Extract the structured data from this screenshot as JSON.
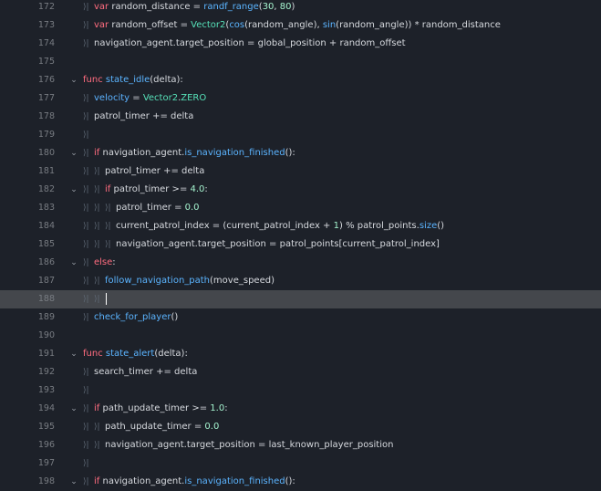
{
  "editor": {
    "current_line": "188",
    "lines": [
      {
        "num": "172",
        "fold": false,
        "tokens": [
          {
            "tab": 1
          },
          {
            "t": "var",
            "c": "kw-red"
          },
          {
            "t": " random_distance = "
          },
          {
            "t": "randf_range",
            "c": "fn"
          },
          {
            "t": "("
          },
          {
            "t": "30",
            "c": "num"
          },
          {
            "t": ", "
          },
          {
            "t": "80",
            "c": "num"
          },
          {
            "t": ")"
          }
        ]
      },
      {
        "num": "173",
        "fold": false,
        "tokens": [
          {
            "tab": 1
          },
          {
            "t": "var",
            "c": "kw-red"
          },
          {
            "t": " random_offset = "
          },
          {
            "t": "Vector2",
            "c": "type-green"
          },
          {
            "t": "("
          },
          {
            "t": "cos",
            "c": "fn"
          },
          {
            "t": "(random_angle), "
          },
          {
            "t": "sin",
            "c": "fn"
          },
          {
            "t": "(random_angle)) * random_distance"
          }
        ]
      },
      {
        "num": "174",
        "fold": false,
        "tokens": [
          {
            "tab": 1
          },
          {
            "t": "navigation_agent."
          },
          {
            "t": "target_position",
            "c": ""
          },
          {
            "t": " = "
          },
          {
            "t": "global_position",
            "c": ""
          },
          {
            "t": " + random_offset"
          }
        ]
      },
      {
        "num": "175",
        "fold": false,
        "tokens": []
      },
      {
        "num": "176",
        "fold": true,
        "tokens": [
          {
            "t": "func",
            "c": "kw-red"
          },
          {
            "t": " "
          },
          {
            "t": "state_idle",
            "c": "fn"
          },
          {
            "t": "(delta):"
          }
        ]
      },
      {
        "num": "177",
        "fold": false,
        "tokens": [
          {
            "tab": 1
          },
          {
            "t": "velocity",
            "c": "builtin"
          },
          {
            "t": " = "
          },
          {
            "t": "Vector2",
            "c": "type-green"
          },
          {
            "t": "."
          },
          {
            "t": "ZERO",
            "c": "type-green"
          }
        ]
      },
      {
        "num": "178",
        "fold": false,
        "tokens": [
          {
            "tab": 1
          },
          {
            "t": "patrol_timer += delta"
          }
        ]
      },
      {
        "num": "179",
        "fold": false,
        "tokens": [
          {
            "tab": 1
          }
        ]
      },
      {
        "num": "180",
        "fold": true,
        "tokens": [
          {
            "tab": 1
          },
          {
            "t": "if",
            "c": "kw-red"
          },
          {
            "t": " navigation_agent."
          },
          {
            "t": "is_navigation_finished",
            "c": "fn"
          },
          {
            "t": "():"
          }
        ]
      },
      {
        "num": "181",
        "fold": false,
        "tokens": [
          {
            "tab": 1
          },
          {
            "tab": 1
          },
          {
            "t": "patrol_timer += delta"
          }
        ]
      },
      {
        "num": "182",
        "fold": true,
        "tokens": [
          {
            "tab": 1
          },
          {
            "tab": 1
          },
          {
            "t": "if",
            "c": "kw-red"
          },
          {
            "t": " patrol_timer >= "
          },
          {
            "t": "4.0",
            "c": "num"
          },
          {
            "t": ":"
          }
        ]
      },
      {
        "num": "183",
        "fold": false,
        "tokens": [
          {
            "tab": 1
          },
          {
            "tab": 1
          },
          {
            "tab": 1
          },
          {
            "t": "patrol_timer = "
          },
          {
            "t": "0.0",
            "c": "num"
          }
        ]
      },
      {
        "num": "184",
        "fold": false,
        "tokens": [
          {
            "tab": 1
          },
          {
            "tab": 1
          },
          {
            "tab": 1
          },
          {
            "t": "current_patrol_index = (current_patrol_index + "
          },
          {
            "t": "1",
            "c": "num"
          },
          {
            "t": ") % patrol_points."
          },
          {
            "t": "size",
            "c": "fn"
          },
          {
            "t": "()"
          }
        ]
      },
      {
        "num": "185",
        "fold": false,
        "tokens": [
          {
            "tab": 1
          },
          {
            "tab": 1
          },
          {
            "tab": 1
          },
          {
            "t": "navigation_agent."
          },
          {
            "t": "target_position",
            "c": ""
          },
          {
            "t": " = patrol_points[current_patrol_index]"
          }
        ]
      },
      {
        "num": "186",
        "fold": true,
        "tokens": [
          {
            "tab": 1
          },
          {
            "t": "else",
            "c": "kw-red"
          },
          {
            "t": ":"
          }
        ]
      },
      {
        "num": "187",
        "fold": false,
        "tokens": [
          {
            "tab": 1
          },
          {
            "tab": 1
          },
          {
            "t": "follow_navigation_path",
            "c": "fn"
          },
          {
            "t": "(move_speed)"
          }
        ]
      },
      {
        "num": "188",
        "fold": false,
        "current": true,
        "tokens": [
          {
            "tab": 1
          },
          {
            "tab": 1
          },
          {
            "caret": true
          }
        ]
      },
      {
        "num": "189",
        "fold": false,
        "tokens": [
          {
            "tab": 1
          },
          {
            "t": "check_for_player",
            "c": "fn"
          },
          {
            "t": "()"
          }
        ]
      },
      {
        "num": "190",
        "fold": false,
        "tokens": []
      },
      {
        "num": "191",
        "fold": true,
        "tokens": [
          {
            "t": "func",
            "c": "kw-red"
          },
          {
            "t": " "
          },
          {
            "t": "state_alert",
            "c": "fn"
          },
          {
            "t": "(delta):"
          }
        ]
      },
      {
        "num": "192",
        "fold": false,
        "tokens": [
          {
            "tab": 1
          },
          {
            "t": "search_timer += delta"
          }
        ]
      },
      {
        "num": "193",
        "fold": false,
        "tokens": [
          {
            "tab": 1
          }
        ]
      },
      {
        "num": "194",
        "fold": true,
        "tokens": [
          {
            "tab": 1
          },
          {
            "t": "if",
            "c": "kw-red"
          },
          {
            "t": " path_update_timer >= "
          },
          {
            "t": "1.0",
            "c": "num"
          },
          {
            "t": ":"
          }
        ]
      },
      {
        "num": "195",
        "fold": false,
        "tokens": [
          {
            "tab": 1
          },
          {
            "tab": 1
          },
          {
            "t": "path_update_timer = "
          },
          {
            "t": "0.0",
            "c": "num"
          }
        ]
      },
      {
        "num": "196",
        "fold": false,
        "tokens": [
          {
            "tab": 1
          },
          {
            "tab": 1
          },
          {
            "t": "navigation_agent."
          },
          {
            "t": "target_position",
            "c": ""
          },
          {
            "t": " = last_known_player_position"
          }
        ]
      },
      {
        "num": "197",
        "fold": false,
        "tokens": [
          {
            "tab": 1
          }
        ]
      },
      {
        "num": "198",
        "fold": true,
        "tokens": [
          {
            "tab": 1
          },
          {
            "t": "if",
            "c": "kw-red"
          },
          {
            "t": " navigation_agent."
          },
          {
            "t": "is_navigation_finished",
            "c": "fn"
          },
          {
            "t": "():"
          }
        ]
      }
    ]
  },
  "icons": {
    "tab_glyph": "⟩|",
    "fold_glyph": "⌄",
    "tab_icon_name": "tab-indent-icon",
    "fold_icon_name": "fold-arrow-icon"
  },
  "colors": {
    "background": "#1d2129",
    "current_line": "#44474c",
    "line_number": "#787c82",
    "keyword": "#ff6c7f",
    "function": "#5bb4ff",
    "type": "#56e0b8",
    "number": "#a4f3ce",
    "text": "#d6d9de"
  }
}
